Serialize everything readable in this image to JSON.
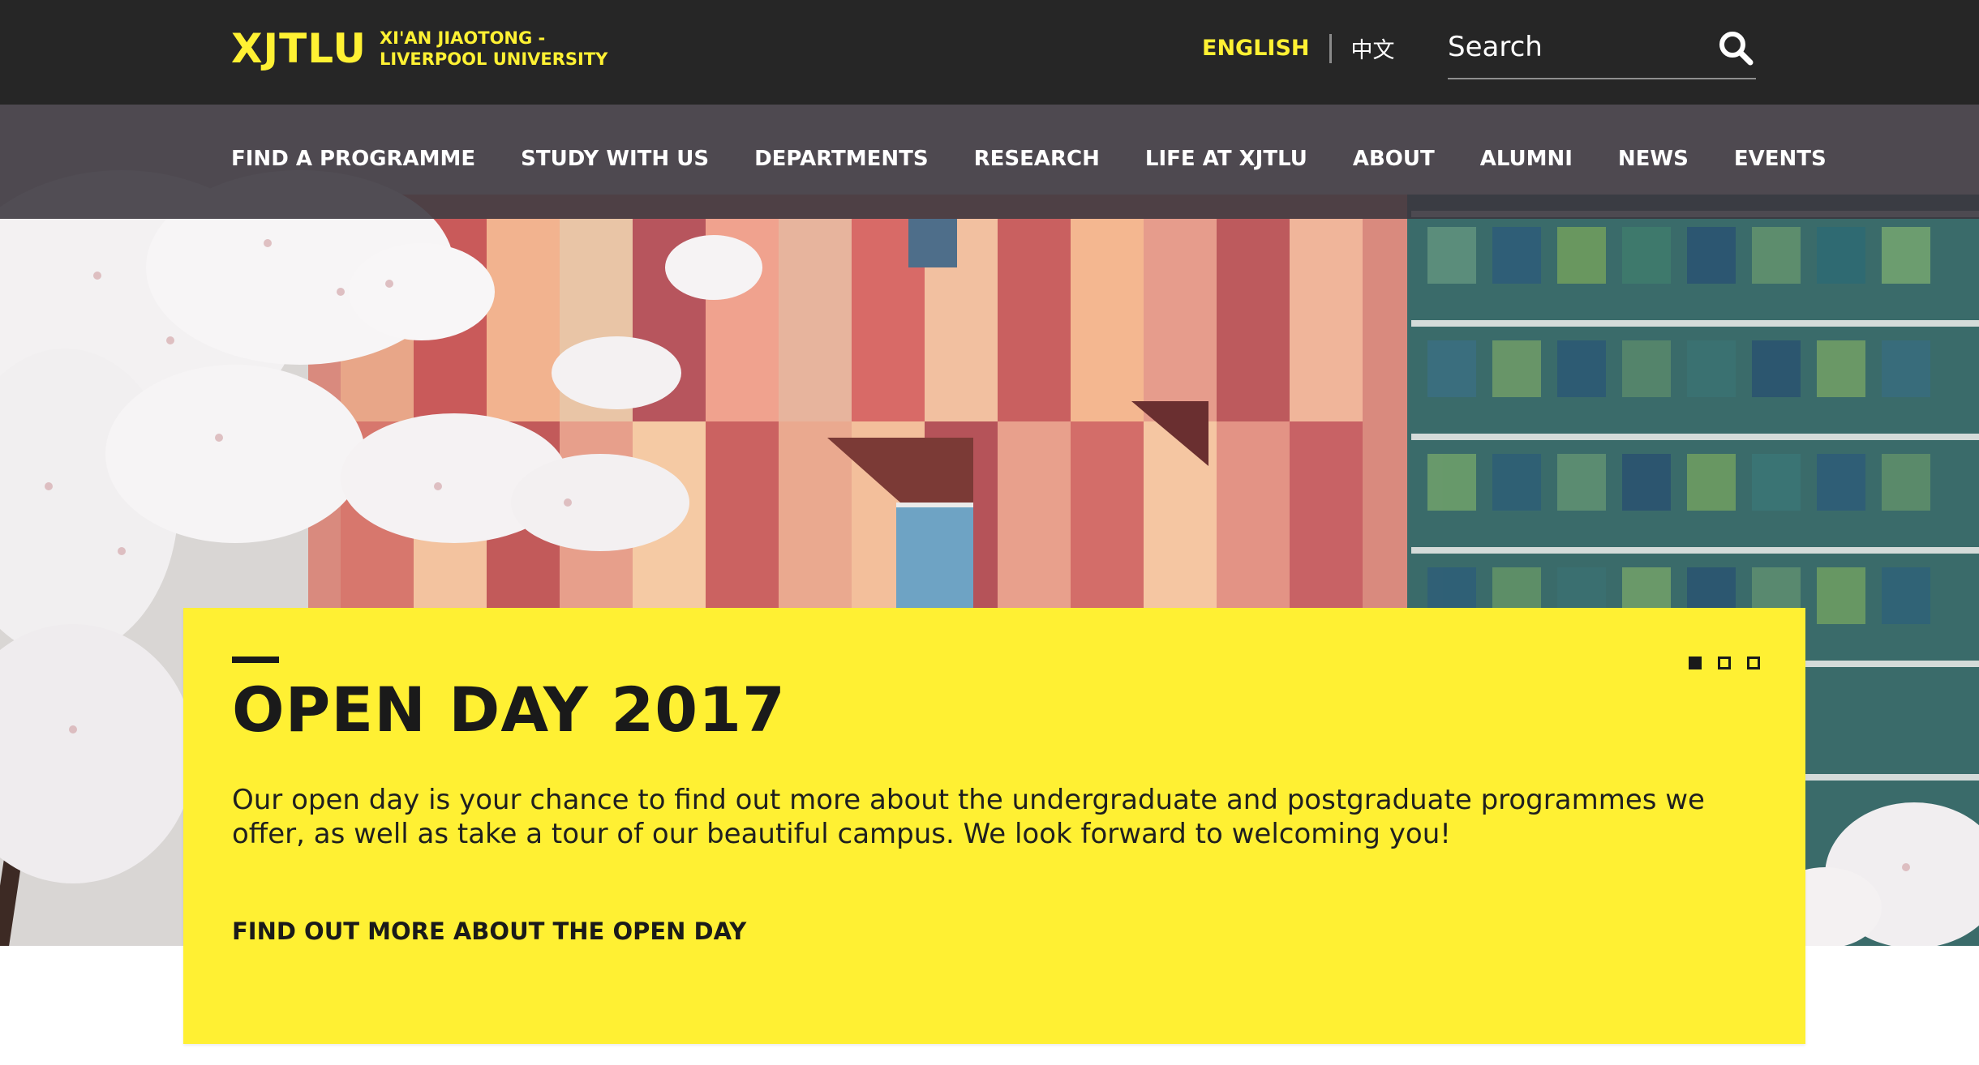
{
  "header": {
    "logo": {
      "mark": "XJTLU",
      "line1": "XI'AN JIAOTONG -",
      "line2": "LIVERPOOL UNIVERSITY"
    },
    "languages": {
      "english": "ENGLISH",
      "chinese": "中文",
      "active": "english"
    },
    "search": {
      "placeholder": "Search"
    }
  },
  "nav": {
    "items": [
      {
        "label": "FIND A PROGRAMME"
      },
      {
        "label": "STUDY WITH US"
      },
      {
        "label": "DEPARTMENTS"
      },
      {
        "label": "RESEARCH"
      },
      {
        "label": "LIFE AT XJTLU"
      },
      {
        "label": "ABOUT"
      },
      {
        "label": "ALUMNI"
      },
      {
        "label": "NEWS"
      },
      {
        "label": "EVENTS"
      }
    ]
  },
  "hero": {
    "image": "campus-building-cherry-blossom",
    "slide": {
      "title": "OPEN DAY 2017",
      "text": "Our open day is your chance to find out more about the undergraduate and postgraduate programmes we offer, as well as take a tour of our beautiful campus. We look forward to welcoming you!",
      "cta": "FIND OUT MORE ABOUT THE OPEN DAY"
    },
    "slides_total": 3,
    "active_slide": 1
  },
  "colors": {
    "brand_yellow": "#fff033",
    "topbar": "#262626",
    "nav_overlay": "#3a353e",
    "text_dark": "#1a1a1a"
  }
}
